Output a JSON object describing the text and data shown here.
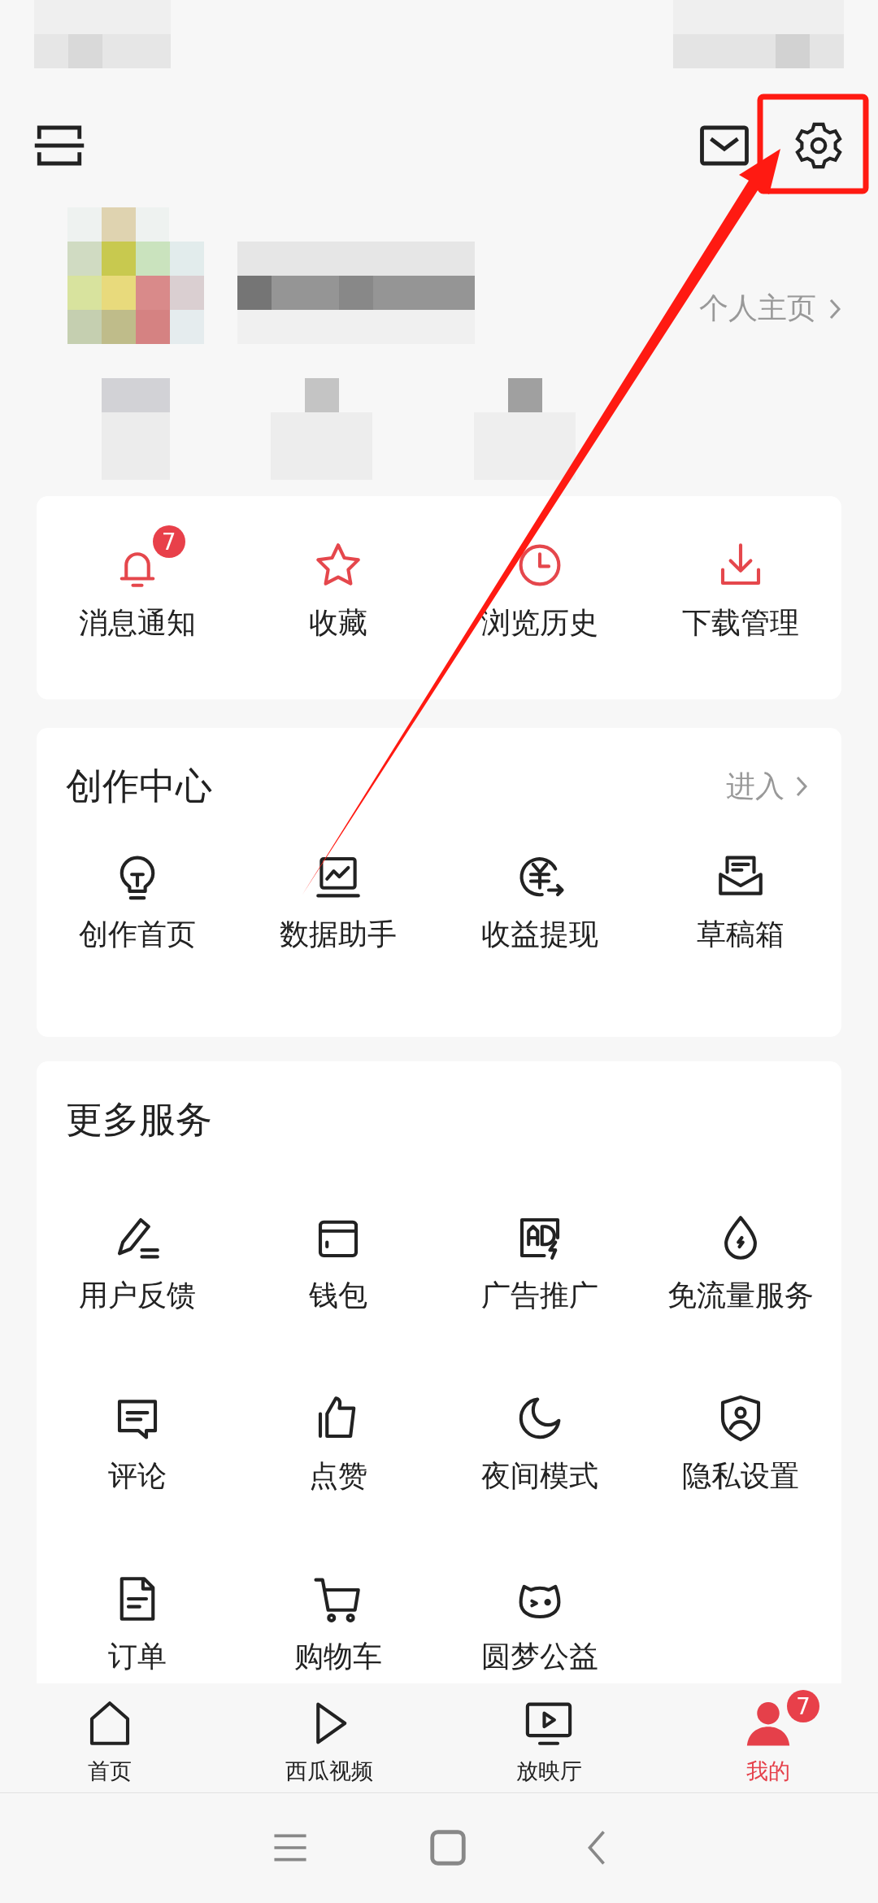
{
  "profile": {
    "homepage_link": "个人主页"
  },
  "quick_actions": [
    {
      "label": "消息通知",
      "badge": "7"
    },
    {
      "label": "收藏"
    },
    {
      "label": "浏览历史"
    },
    {
      "label": "下载管理"
    }
  ],
  "creation_center": {
    "title": "创作中心",
    "enter_link": "进入",
    "items": [
      {
        "label": "创作首页"
      },
      {
        "label": "数据助手"
      },
      {
        "label": "收益提现"
      },
      {
        "label": "草稿箱"
      }
    ]
  },
  "more_services": {
    "title": "更多服务",
    "items": [
      {
        "label": "用户反馈"
      },
      {
        "label": "钱包"
      },
      {
        "label": "广告推广"
      },
      {
        "label": "免流量服务"
      },
      {
        "label": "评论"
      },
      {
        "label": "点赞"
      },
      {
        "label": "夜间模式"
      },
      {
        "label": "隐私设置"
      },
      {
        "label": "订单"
      },
      {
        "label": "购物车"
      },
      {
        "label": "圆梦公益"
      }
    ]
  },
  "tab_bar": [
    {
      "label": "首页",
      "selected": false
    },
    {
      "label": "西瓜视频",
      "selected": false
    },
    {
      "label": "放映厅",
      "selected": false
    },
    {
      "label": "我的",
      "selected": true,
      "badge": "7"
    }
  ]
}
